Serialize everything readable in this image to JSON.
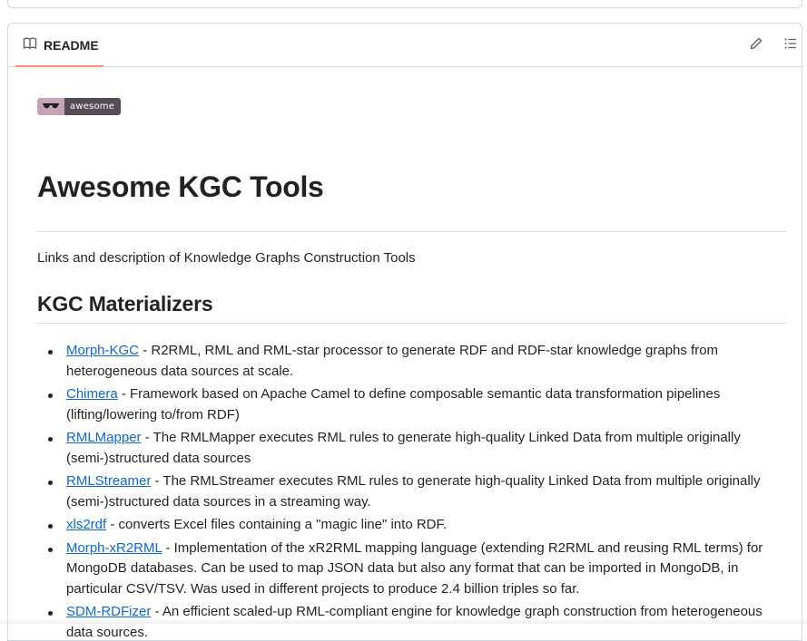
{
  "readme": {
    "tab_label": "README",
    "icons": {
      "tab": "book-icon",
      "edit": "pencil-icon",
      "toc": "list-icon"
    }
  },
  "content": {
    "badge_text": "awesome",
    "badge_icon": "sunglasses-icon",
    "title": "Awesome KGC Tools",
    "description": "Links and description of Knowledge Graphs Construction Tools",
    "section_heading": "KGC Materializers",
    "tools": [
      {
        "name": "Morph-KGC",
        "description": " - R2RML, RML and RML-star processor to generate RDF and RDF-star knowledge graphs from heterogeneous data sources at scale."
      },
      {
        "name": "Chimera",
        "description": " - Framework based on Apache Camel to define composable semantic data transformation pipelines (lifting/lowering to/from RDF)"
      },
      {
        "name": "RMLMapper",
        "description": " - The RMLMapper executes RML rules to generate high-quality Linked Data from multiple originally (semi-)structured data sources"
      },
      {
        "name": "RMLStreamer",
        "description": " - The RMLStreamer executes RML rules to generate high-quality Linked Data from multiple originally (semi-)structured data sources in a streaming way."
      },
      {
        "name": "xls2rdf",
        "description": " - converts Excel files containing a \"magic line\" into RDF."
      },
      {
        "name": "Morph-xR2RML",
        "description": " - Implementation of the xR2RML mapping language (extending R2RML and reusing RML terms) for MongoDB databases. Can be used to map JSON data but also any format that can be imported in MongoDB, in particular CSV/TSV. Was used in different projects to produce 2.4 billion triples so far."
      },
      {
        "name": "SDM-RDFizer",
        "description": " - An efficient scaled-up RML-compliant engine for knowledge graph construction from heterogeneous data sources."
      }
    ]
  }
}
